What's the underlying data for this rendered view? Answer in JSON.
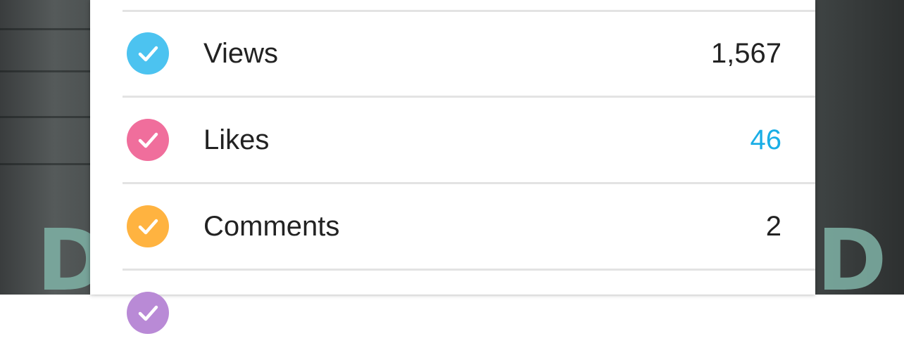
{
  "stats": [
    {
      "label": "Views",
      "value": "1,567",
      "icon": "check-circle-icon",
      "icon_color": "#4cc3f0",
      "value_color": "#222222"
    },
    {
      "label": "Likes",
      "value": "46",
      "icon": "check-circle-icon",
      "icon_color": "#f06e9c",
      "value_color": "#1aaee6"
    },
    {
      "label": "Comments",
      "value": "2",
      "icon": "check-circle-icon",
      "icon_color": "#ffb340",
      "value_color": "#222222"
    },
    {
      "label": "",
      "value": "",
      "icon": "check-circle-icon",
      "icon_color": "#b98ad6",
      "value_color": "#222222"
    }
  ],
  "background": {
    "letters": [
      "D",
      "D"
    ],
    "letter_color": "#7fb2a6"
  }
}
